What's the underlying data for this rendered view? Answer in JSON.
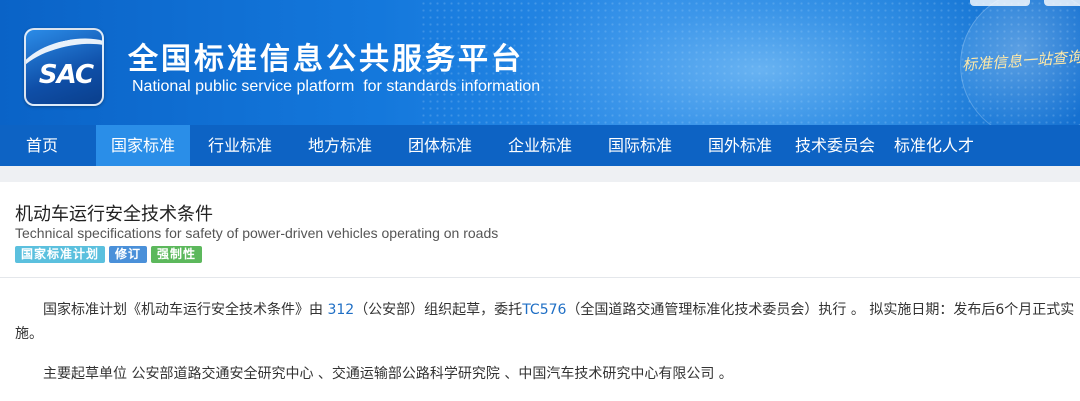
{
  "header": {
    "logo_text": "SAC",
    "title": "全国标准信息公共服务平台",
    "subtitle": "National public service platform  for standards information",
    "slogan": "标准信息一站查询"
  },
  "nav": {
    "items": [
      {
        "label": "首页"
      },
      {
        "label": "国家标准"
      },
      {
        "label": "行业标准"
      },
      {
        "label": "地方标准"
      },
      {
        "label": "团体标准"
      },
      {
        "label": "企业标准"
      },
      {
        "label": "国际标准"
      },
      {
        "label": "国外标准"
      },
      {
        "label": "技术委员会"
      },
      {
        "label": "标准化人才"
      }
    ],
    "active": "国家标准"
  },
  "standard": {
    "title_cn": "机动车运行安全技术条件",
    "title_en": "Technical specifications for safety of power-driven vehicles operating on roads",
    "tags": [
      {
        "label": "国家标准计划",
        "color": "#5bc0de"
      },
      {
        "label": "修订",
        "color": "#4a90d9"
      },
      {
        "label": "强制性",
        "color": "#5cb85c"
      }
    ]
  },
  "content": {
    "p1_a": "国家标准计划《机动车运行安全技术条件》由 ",
    "p1_link1": "312",
    "p1_b": "（公安部）组织起草，委托",
    "p1_link2": "TC576",
    "p1_c": "（全国道路交通管理标准化技术委员会）执行 。 拟实施日期：发布后6个月正式实施。",
    "p2": "主要起草单位 公安部道路交通安全研究中心 、交通运输部公路科学研究院 、中国汽车技术研究中心有限公司 。"
  }
}
